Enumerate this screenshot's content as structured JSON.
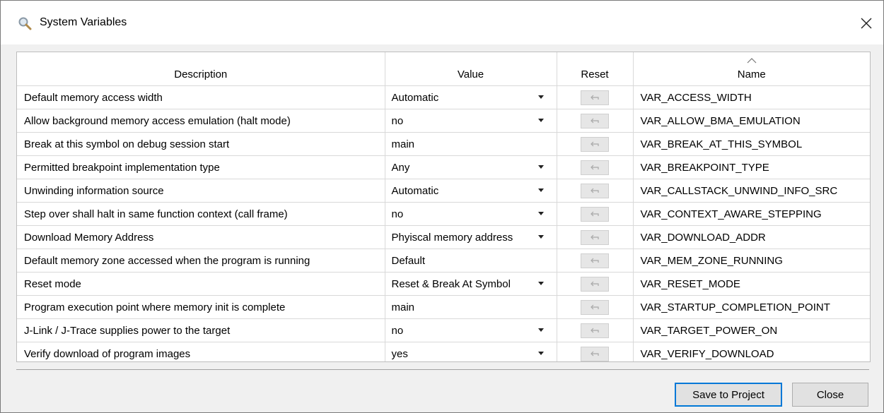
{
  "window": {
    "title": "System Variables",
    "icon": "magnifier-icon",
    "close_icon": "close-icon"
  },
  "table": {
    "columns": [
      "Description",
      "Value",
      "Reset",
      "Name"
    ],
    "sorted_column": "Name",
    "rows": [
      {
        "description": "Default memory access width",
        "value": "Automatic",
        "dropdown": true,
        "name": "VAR_ACCESS_WIDTH"
      },
      {
        "description": "Allow background memory access emulation (halt mode)",
        "value": "no",
        "dropdown": true,
        "name": "VAR_ALLOW_BMA_EMULATION"
      },
      {
        "description": "Break at this symbol on debug session start",
        "value": "main",
        "dropdown": false,
        "name": "VAR_BREAK_AT_THIS_SYMBOL"
      },
      {
        "description": "Permitted breakpoint implementation type",
        "value": "Any",
        "dropdown": true,
        "name": "VAR_BREAKPOINT_TYPE"
      },
      {
        "description": "Unwinding information source",
        "value": "Automatic",
        "dropdown": true,
        "name": "VAR_CALLSTACK_UNWIND_INFO_SRC"
      },
      {
        "description": "Step over shall halt in same function context (call frame)",
        "value": "no",
        "dropdown": true,
        "name": "VAR_CONTEXT_AWARE_STEPPING"
      },
      {
        "description": "Download Memory Address",
        "value": "Phyiscal memory address",
        "dropdown": true,
        "name": "VAR_DOWNLOAD_ADDR"
      },
      {
        "description": "Default memory zone accessed when the program is running",
        "value": "Default",
        "dropdown": false,
        "name": "VAR_MEM_ZONE_RUNNING"
      },
      {
        "description": "Reset mode",
        "value": "Reset & Break At Symbol",
        "dropdown": true,
        "name": "VAR_RESET_MODE"
      },
      {
        "description": "Program execution point where memory init is complete",
        "value": "main",
        "dropdown": false,
        "name": "VAR_STARTUP_COMPLETION_POINT"
      },
      {
        "description": "J-Link / J-Trace supplies power to the target",
        "value": "no",
        "dropdown": true,
        "name": "VAR_TARGET_POWER_ON"
      },
      {
        "description": "Verify download of program images",
        "value": "yes",
        "dropdown": true,
        "name": "VAR_VERIFY_DOWNLOAD"
      }
    ]
  },
  "buttons": {
    "save": "Save to Project",
    "close": "Close"
  }
}
